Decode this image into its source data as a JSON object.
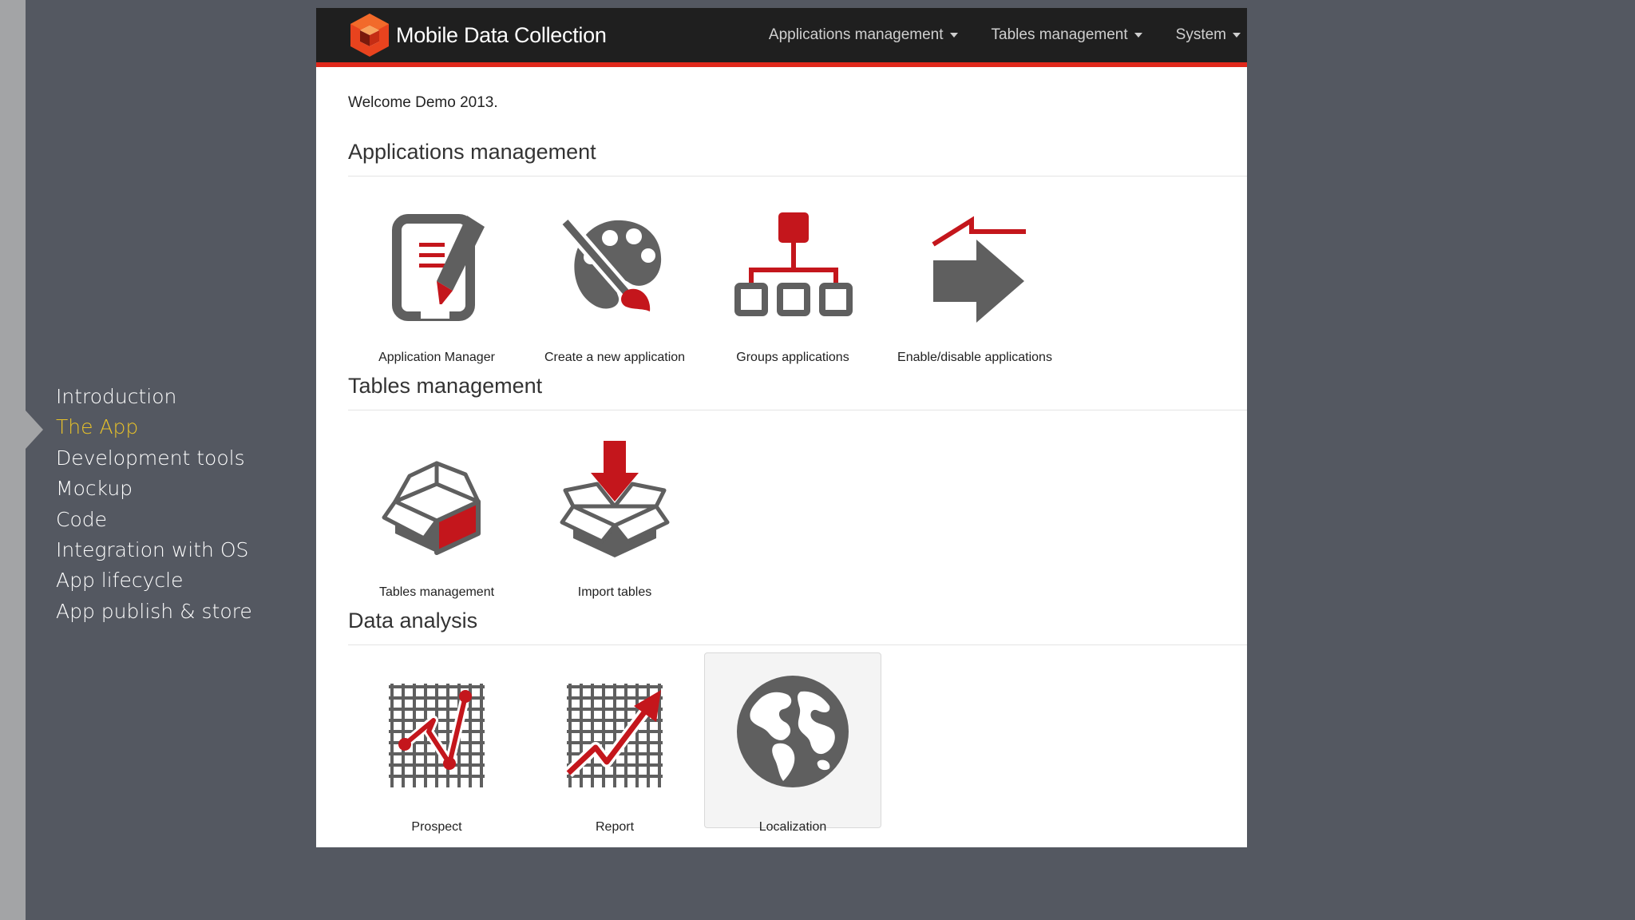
{
  "toc": {
    "items": [
      {
        "label": "Introduction"
      },
      {
        "label": "The App"
      },
      {
        "label": "Development tools"
      },
      {
        "label": "Mockup"
      },
      {
        "label": "Code"
      },
      {
        "label": "Integration with OS"
      },
      {
        "label": "App lifecycle"
      },
      {
        "label": "App publish & store"
      }
    ],
    "active_index": 1,
    "active_color": "#e8c229"
  },
  "app": {
    "title": "Mobile Data Collection",
    "accent_color": "#e0281b",
    "menu": [
      {
        "label": "Applications management"
      },
      {
        "label": "Tables management"
      },
      {
        "label": "System"
      }
    ],
    "welcome": "Welcome Demo 2013.",
    "sections": [
      {
        "title": "Applications management",
        "tiles": [
          {
            "label": "Application Manager",
            "icon": "edit-document-icon"
          },
          {
            "label": "Create a new application",
            "icon": "palette-brush-icon"
          },
          {
            "label": "Groups applications",
            "icon": "hierarchy-icon"
          },
          {
            "label": "Enable/disable applications",
            "icon": "switch-arrow-icon"
          }
        ]
      },
      {
        "title": "Tables management",
        "tiles": [
          {
            "label": "Tables management",
            "icon": "open-box-icon"
          },
          {
            "label": "Import tables",
            "icon": "box-import-icon"
          }
        ]
      },
      {
        "title": "Data analysis",
        "tiles": [
          {
            "label": "Prospect",
            "icon": "grid-path-icon"
          },
          {
            "label": "Report",
            "icon": "grid-trend-icon"
          },
          {
            "label": "Localization",
            "icon": "globe-icon"
          }
        ]
      }
    ]
  }
}
